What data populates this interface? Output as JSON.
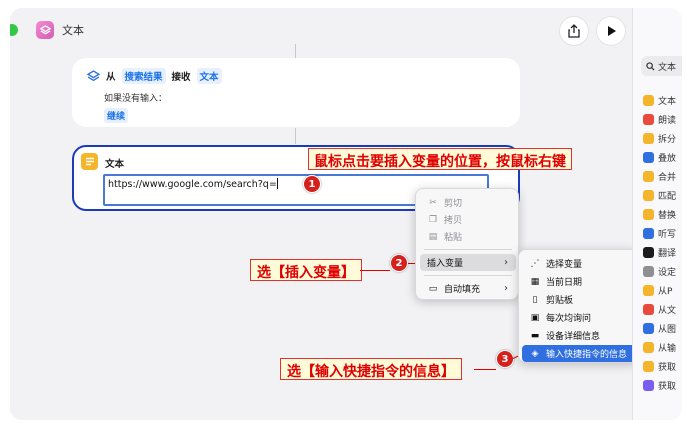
{
  "app": {
    "title": "文本"
  },
  "card1": {
    "from": "从",
    "source_token": "搜索结果",
    "receive": "接收",
    "type_token": "文本",
    "if_no_input": "如果没有输入：",
    "continue_token": "继续"
  },
  "card2": {
    "title": "文本",
    "url": "https://www.google.com/search?q="
  },
  "context_menu": {
    "cut": "剪切",
    "copy": "拷贝",
    "paste": "粘贴",
    "insert_variable": "插入变量",
    "autofill": "自动填充"
  },
  "submenu": {
    "items": [
      "选择变量",
      "当前日期",
      "剪贴板",
      "每次均询问",
      "设备详细信息",
      "输入快捷指令的信息"
    ]
  },
  "callouts": {
    "c1": "鼠标点击要插入变量的位置，按鼠标右键",
    "c2": "选【插入变量】",
    "c3": "选【输入快捷指令的信息】"
  },
  "badges": [
    "1",
    "2",
    "3"
  ],
  "sidebar": {
    "search": "文本",
    "items": [
      "文本",
      "朗读",
      "拆分",
      "叠放",
      "合并",
      "匹配",
      "替换",
      "听写",
      "翻译",
      "设定",
      "从P",
      "从文",
      "从图",
      "从输",
      "获取",
      "获取"
    ],
    "colors": [
      "#f5b52a",
      "#e84b3c",
      "#f5b52a",
      "#2f6fe0",
      "#f5b52a",
      "#f5b52a",
      "#f5b52a",
      "#2f6fe0",
      "#1c1c1e",
      "#8e8e93",
      "#f5b52a",
      "#e84b3c",
      "#2f6fe0",
      "#f5b52a",
      "#f5b52a",
      "#7b5cf0"
    ]
  }
}
